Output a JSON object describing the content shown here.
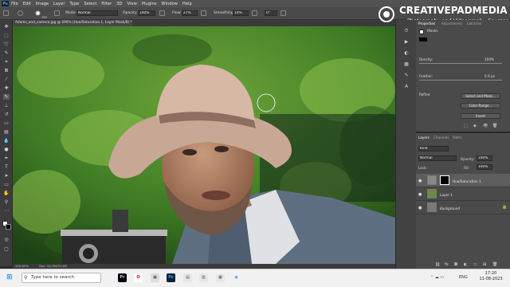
{
  "menu": {
    "app_icon": "Ps",
    "items": [
      "File",
      "Edit",
      "Image",
      "Layer",
      "Type",
      "Select",
      "Filter",
      "3D",
      "View",
      "Plugins",
      "Window",
      "Help"
    ]
  },
  "options": {
    "brush_size": "250",
    "mode_label": "Mode:",
    "mode_value": "Normal",
    "opacity_label": "Opacity:",
    "opacity_value": "100%",
    "flow_label": "Flow:",
    "flow_value": "27%",
    "smoothing_label": "Smoothing:",
    "smoothing_value": "10%",
    "angle_value": "0°"
  },
  "document": {
    "tab_title": "Adams_and_camera.jpg @ 206% (Hue/Saturation 1, Layer Mask/8) *",
    "zoom": "205.62%",
    "doc_info": "Doc: 24.7M/70.1M"
  },
  "watermark": {
    "brand": "CREATIVEPADMEDIA",
    "tagline": "Photography and Videography Courses"
  },
  "properties": {
    "tabs": [
      "Properties",
      "Adjustments",
      "Libraries"
    ],
    "section": "Masks",
    "density_label": "Density:",
    "density_value": "100%",
    "feather_label": "Feather:",
    "feather_value": "0.0 px",
    "refine_label": "Refine:",
    "select_mask_btn": "Select and Mask...",
    "color_range_btn": "Color Range...",
    "invert_btn": "Invert"
  },
  "layers_panel": {
    "tabs": [
      "Layers",
      "Channels",
      "Paths"
    ],
    "kind_label": "Kind",
    "blend_mode": "Normal",
    "opacity_label": "Opacity:",
    "opacity_value": "100%",
    "lock_label": "Lock:",
    "fill_label": "Fill:",
    "fill_value": "100%",
    "layers": [
      {
        "name": "Hue/Saturation 1",
        "selected": true
      },
      {
        "name": "Layer 1",
        "selected": false
      },
      {
        "name": "Background",
        "selected": false
      }
    ]
  },
  "taskbar": {
    "search_placeholder": "Type here to search",
    "language": "ENG",
    "time": "17:20",
    "date": "11-08-2023"
  },
  "colors": {
    "accent": "#31a8ff",
    "menu_bg": "#535353",
    "panel_bg": "#4a4a4a",
    "taskbar_bg": "#f1f1f1"
  }
}
